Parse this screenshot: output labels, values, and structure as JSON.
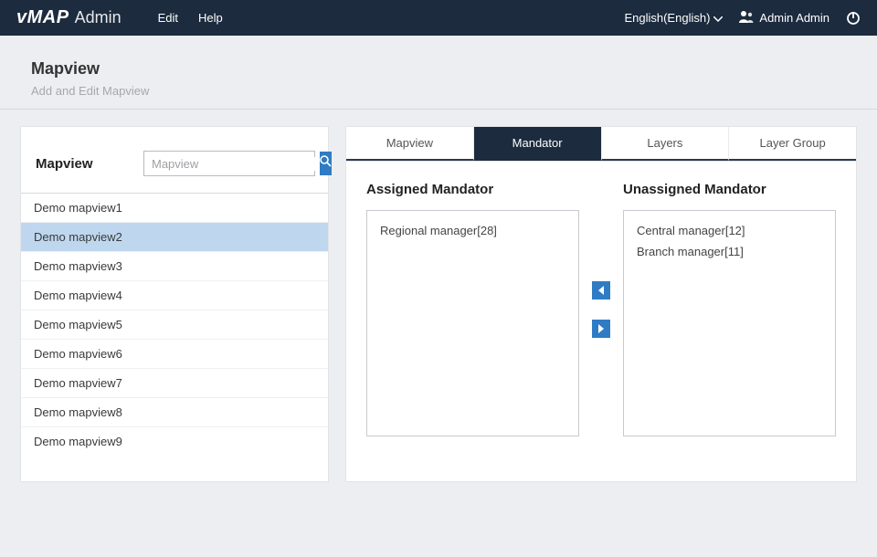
{
  "header": {
    "brand_logo": "vMAP",
    "brand_sub": "Admin",
    "menu": {
      "edit": "Edit",
      "help": "Help"
    },
    "language": "English(English)",
    "user_name": "Admin Admin"
  },
  "page": {
    "title": "Mapview",
    "subtitle": "Add and Edit Mapview"
  },
  "sidebar": {
    "title": "Mapview",
    "search_placeholder": "Mapview",
    "items": [
      "Demo mapview1",
      "Demo mapview2",
      "Demo mapview3",
      "Demo mapview4",
      "Demo mapview5",
      "Demo mapview6",
      "Demo mapview7",
      "Demo mapview8",
      "Demo mapview9"
    ],
    "selected_index": 1
  },
  "tabs": {
    "items": [
      "Mapview",
      "Mandator",
      "Layers",
      "Layer Group"
    ],
    "active_index": 1
  },
  "mandator": {
    "assigned_title": "Assigned Mandator",
    "unassigned_title": "Unassigned Mandator",
    "assigned": [
      "Regional manager[28]"
    ],
    "unassigned": [
      "Central manager[12]",
      "Branch manager[11]"
    ]
  }
}
